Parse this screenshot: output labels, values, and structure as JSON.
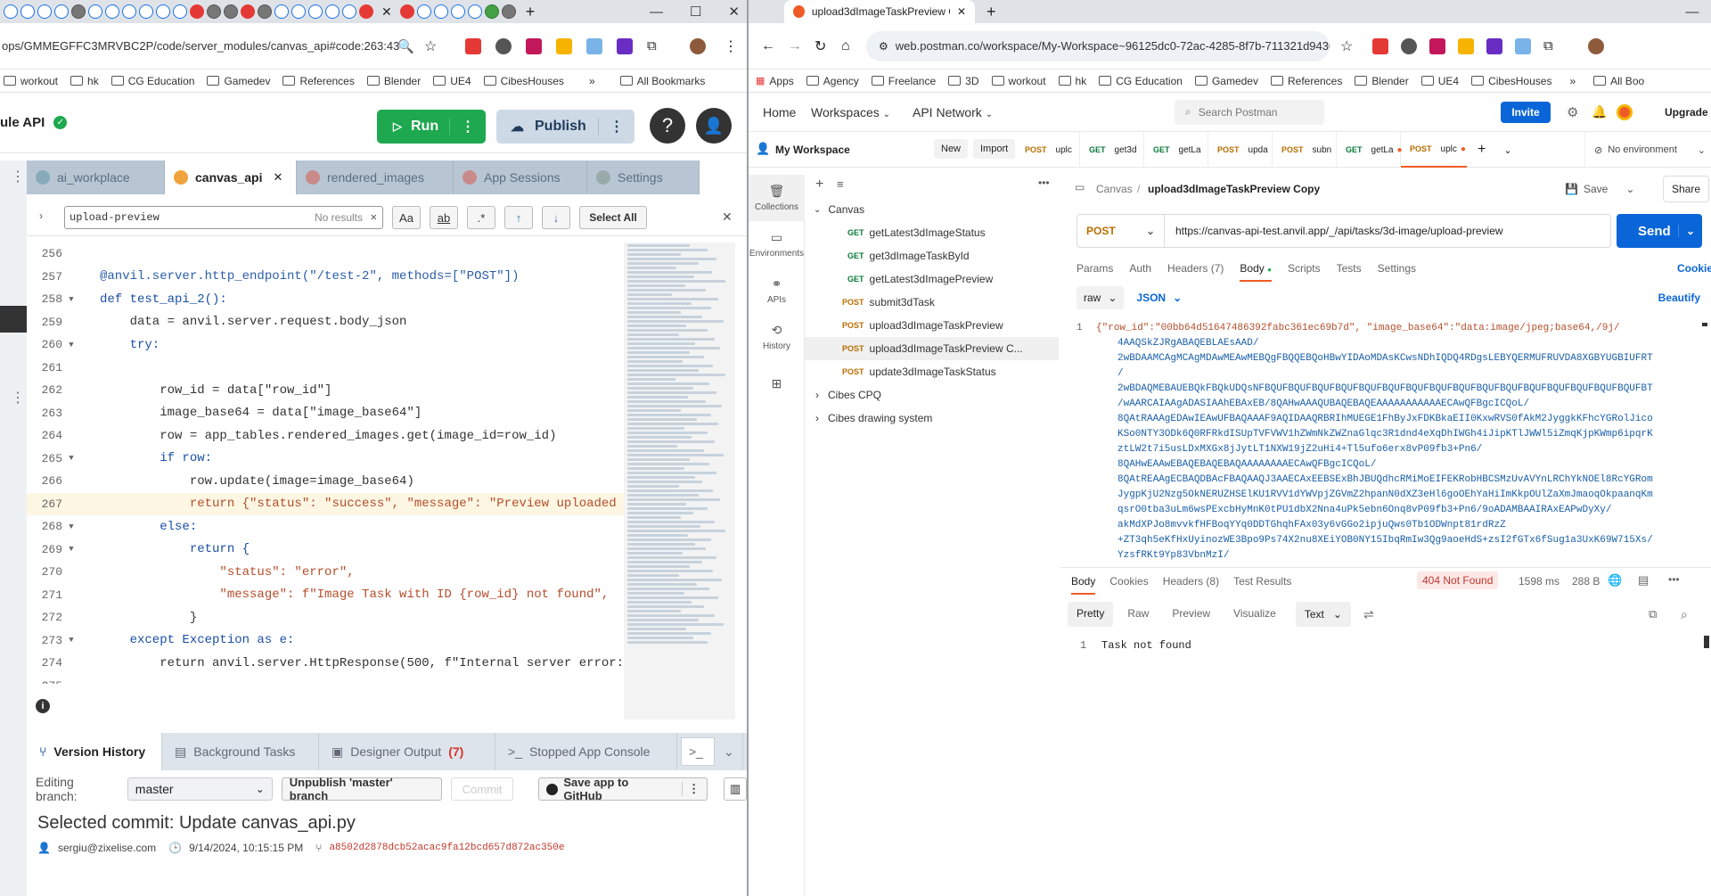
{
  "left": {
    "address": "ops/GMMEGFFC3MRVBC2P/code/server_modules/canvas_api#code:263:43",
    "bookmarks": [
      "workout",
      "hk",
      "CG Education",
      "Gamedev",
      "References",
      "Blender",
      "UE4",
      "CibesHouses"
    ],
    "all_bookmarks": "All Bookmarks",
    "app_title": "ule API",
    "run_label": "Run",
    "publish_label": "Publish",
    "help_glyph": "?",
    "editor_tabs": [
      "ai_workplace",
      "canvas_api",
      "rendered_images",
      "App Sessions",
      "Settings"
    ],
    "find": {
      "value": "upload-preview",
      "status": "No results",
      "aa": "Aa",
      "ab": "ab",
      "regex": ".*",
      "select_all": "Select All"
    },
    "code_lines": [
      {
        "n": "256",
        "t": ""
      },
      {
        "n": "257",
        "t": "@anvil.server.http_endpoint(\"/test-2\", methods=[\"POST\"])"
      },
      {
        "n": "258",
        "t": "def test_api_2():"
      },
      {
        "n": "259",
        "t": "    data = anvil.server.request.body_json"
      },
      {
        "n": "260",
        "t": "    try:"
      },
      {
        "n": "261",
        "t": ""
      },
      {
        "n": "262",
        "t": "        row_id = data[\"row_id\"]"
      },
      {
        "n": "263",
        "t": "        image_base64 = data[\"image_base64\"]"
      },
      {
        "n": "264",
        "t": "        row = app_tables.rendered_images.get(image_id=row_id)"
      },
      {
        "n": "265",
        "t": "        if row:"
      },
      {
        "n": "266",
        "t": "            row.update(image=image_base64)"
      },
      {
        "n": "267",
        "t": "            return {\"status\": \"success\", \"message\": \"Preview uploaded succes"
      },
      {
        "n": "268",
        "t": "        else:"
      },
      {
        "n": "269",
        "t": "            return {"
      },
      {
        "n": "270",
        "t": "                \"status\": \"error\","
      },
      {
        "n": "271",
        "t": "                \"message\": f\"Image Task with ID {row_id} not found\","
      },
      {
        "n": "272",
        "t": "            }"
      },
      {
        "n": "273",
        "t": "    except Exception as e:"
      },
      {
        "n": "274",
        "t": "        return anvil.server.HttpResponse(500, f\"Internal server error: {str"
      },
      {
        "n": "275",
        "t": ""
      }
    ],
    "bottom_tabs": [
      "Version History",
      "Background Tasks",
      "Designer Output",
      "Stopped App Console"
    ],
    "designer_count": "(7)",
    "editing_branch_label": "Editing branch:",
    "branch": "master",
    "unpublish": "Unpublish 'master' branch",
    "commit": "Commit",
    "save_github": "Save app to GitHub",
    "selected_commit": "Selected commit: Update canvas_api.py",
    "commit_user": "sergiu@zixelise.com",
    "commit_time": "9/14/2024, 10:15:15 PM",
    "commit_hash": "a8502d2878dcb52acac9fa12bcd657d872ac350e"
  },
  "right": {
    "tab_title": "upload3dImageTaskPreview Co",
    "address": "web.postman.co/workspace/My-Workspace~96125dc0-72ac-4285-8f7b-711321d9430f/request/1...",
    "bookmarks": [
      "Apps",
      "Agency",
      "Freelance",
      "3D",
      "workout",
      "hk",
      "CG Education",
      "Gamedev",
      "References",
      "Blender",
      "UE4",
      "CibesHouses"
    ],
    "all_bookmarks": "All Boo",
    "nav": [
      "Home",
      "Workspaces",
      "API Network"
    ],
    "search": "Search Postman",
    "invite": "Invite",
    "upgrade": "Upgrade",
    "workspace": "My Workspace",
    "new": "New",
    "import": "Import",
    "req_tabs": [
      {
        "m": "POST",
        "n": "uplc"
      },
      {
        "m": "GET",
        "n": "get3d"
      },
      {
        "m": "GET",
        "n": "getLa"
      },
      {
        "m": "POST",
        "n": "upda"
      },
      {
        "m": "POST",
        "n": "subn"
      },
      {
        "m": "GET",
        "n": "getLa"
      },
      {
        "m": "POST",
        "n": "uplc"
      }
    ],
    "no_env": "No environment",
    "side": [
      "Collections",
      "Environments",
      "APIs",
      "History"
    ],
    "tree": {
      "canvas": "Canvas",
      "items": [
        {
          "m": "GET",
          "n": "getLatest3dImageStatus"
        },
        {
          "m": "GET",
          "n": "get3dImageTaskById"
        },
        {
          "m": "GET",
          "n": "getLatest3dImagePreview"
        },
        {
          "m": "POST",
          "n": "submit3dTask"
        },
        {
          "m": "POST",
          "n": "upload3dImageTaskPreview"
        },
        {
          "m": "POST",
          "n": "upload3dImageTaskPreview C..."
        },
        {
          "m": "POST",
          "n": "update3dImageTaskStatus"
        }
      ],
      "others": [
        "Cibes CPQ",
        "Cibes drawing system"
      ]
    },
    "breadcrumb": "Canvas",
    "req_name": "upload3dImageTaskPreview Copy",
    "save": "Save",
    "share": "Share",
    "method": "POST",
    "url": "https://canvas-api-test.anvil.app/_/api/tasks/3d-image/upload-preview",
    "send": "Send",
    "params_tabs": [
      "Params",
      "Auth",
      "Headers (7)",
      "Body",
      "Scripts",
      "Tests",
      "Settings"
    ],
    "cookies": "Cookies",
    "raw": "raw",
    "json": "JSON",
    "beautify": "Beautify",
    "body_line_no": "1",
    "body_lines": [
      "{\"row_id\":\"00bb64d51647486392fabc361ec69b7d\", \"image_base64\":\"data:image/jpeg;base64,/9j/",
      "4AAQSkZJRgABAQEBLAEsAAD/",
      "2wBDAAMCAgMCAgMDAwMEAwMEBQgFBQQEBQoHBwYIDAoMDAsKCwsNDhIQDQ4RDgsLEBYQERMUFRUVDA8XGBYUGBIUFRT",
      "/",
      "2wBDAQMEBAUEBQkFBQkUDQsNFBQUFBQUFBQUFBQUFBQUFBQUFBQUFBQUFBQUFBQUFBQUFBQUFBQUFBQUFBQUFBQUFBT",
      "/wAARCAIAAgADASIAAhEBAxEB/8QAHwAAAQUBAQEBAQEAAAAAAAAAAAECAwQFBgcICQoL/",
      "8QAtRAAAgEDAwIEAwUFBAQAAAF9AQIDAAQRBRIhMUEGE1FhByJxFDKBkaEII0KxwRVS0fAkM2JyggkKFhcYGRolJico",
      "KSo0NTY3ODk6Q0RFRkdISUpTVFVWV1hZWmNkZWZnaGlqc3R1dnd4eXqDhIWGh4iJipKTlJWWl5iZmqKjpKWmp6ipqrK",
      "ztLW2t7i5usLDxMXGx8jJytLT1NXW19jZ2uHi4+Tl5ufo6erx8vP09fb3+Pn6/",
      "8QAHwEAAwEBAQEBAQEBAQAAAAAAAAECAwQFBgcICQoL/",
      "8QAtREAAgECBAQDBAcFBAQAAQJ3AAECAxEEBSExBhJBUQdhcRMiMoEIFEKRobHBCSMzUvAVYnLRChYkNOEl8RcYGRom",
      "JygpKjU2Nzg5OkNERUZHSElKU1RVV1dYWVpjZGVmZ2hpanN0dXZ3eHl6goOEhYaHiImKkpOUlZaXmJmaoqOkpaanqKm",
      "qsrO0tba3uLm6wsPExcbHyMnK0tPU1dbX2Nna4uPk5ebn6Onq8vP09fb3+Pn6/9oADAMBAAIRAxEAPwDyXy/",
      "akMdXPJo8mvvkfHFBoqYYq0DDTGhqhFAx03y6vGGo2ipjuQws0Tb1ODWnpt81rdRzZ",
      "+ZT3qh5eKfHxUyinozWE3Bpo9Ps74X2nu8XEiYOB0NY15IbqRmIw3Qg9aoeHdS+zsI2fGTx6fSug1a3UxK69W715Xs/",
      "YzsfRKt9Yp83VbnMzI/"
    ],
    "resp_tabs": [
      "Body",
      "Cookies",
      "Headers (8)",
      "Test Results"
    ],
    "status": "404 Not Found",
    "time": "1598 ms",
    "size": "288 B",
    "view_tabs": [
      "Pretty",
      "Raw",
      "Preview",
      "Visualize"
    ],
    "text_format": "Text",
    "resp_line_no": "1",
    "resp_text": "Task not found"
  }
}
